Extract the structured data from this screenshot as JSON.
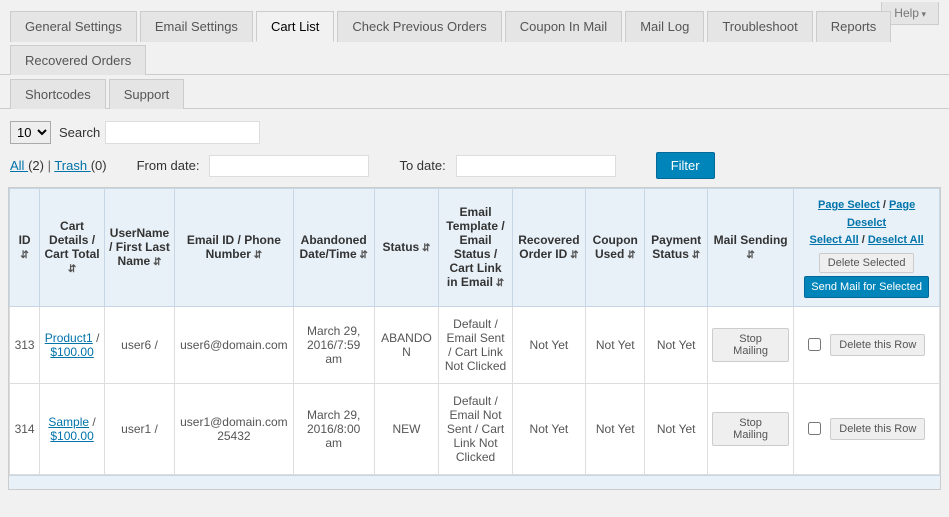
{
  "help": {
    "label": "Help"
  },
  "tabs": {
    "row1": [
      {
        "label": "General Settings",
        "active": false
      },
      {
        "label": "Email Settings",
        "active": false
      },
      {
        "label": "Cart List",
        "active": true
      },
      {
        "label": "Check Previous Orders",
        "active": false
      },
      {
        "label": "Coupon In Mail",
        "active": false
      },
      {
        "label": "Mail Log",
        "active": false
      },
      {
        "label": "Troubleshoot",
        "active": false
      },
      {
        "label": "Reports",
        "active": false
      },
      {
        "label": "Recovered Orders",
        "active": false
      }
    ],
    "row2": [
      {
        "label": "Shortcodes",
        "active": false
      },
      {
        "label": "Support",
        "active": false
      }
    ]
  },
  "toolbar": {
    "page_length": "10",
    "search_label": "Search",
    "search_value": ""
  },
  "filters": {
    "all_label": "All ",
    "all_count": "(2)",
    "sep": " | ",
    "trash_label": "Trash ",
    "trash_count": "(0)",
    "from_label": "From date:",
    "from_value": "",
    "to_label": "To date:",
    "to_value": "",
    "filter_btn": "Filter"
  },
  "table": {
    "headers": {
      "id": "ID",
      "cart": "Cart Details / Cart Total",
      "user": "UserName / First Last Name",
      "email": "Email ID / Phone Number",
      "date": "Abandoned Date/Time",
      "status": "Status",
      "template": "Email Template / Email Status / Cart Link in Email",
      "recov": "Recovered Order ID",
      "coupon": "Coupon Used",
      "pay": "Payment Status",
      "mail": "Mail Sending",
      "actions": {
        "page_select": "Page Select",
        "page_deselect": "Page Deselct",
        "select_all": "Select All",
        "deselect_all": "Deselct All",
        "delete_selected": "Delete Selected",
        "send_mail": "Send Mail for Selected"
      }
    },
    "rows": [
      {
        "id": "313",
        "cart_product": "Product1",
        "cart_sep": " / ",
        "cart_total": "$100.00",
        "user": "user6 /",
        "email": "user6@domain.com",
        "phone": "",
        "date": "March 29, 2016/7:59 am",
        "status": "ABANDON",
        "template": "Default / Email Sent / Cart Link Not Clicked",
        "recov": "Not Yet",
        "coupon": "Not Yet",
        "pay": "Not Yet",
        "mail_btn": "Stop Mailing",
        "delete_btn": "Delete this Row"
      },
      {
        "id": "314",
        "cart_product": "Sample",
        "cart_sep": " / ",
        "cart_total": "$100.00",
        "user": "user1 /",
        "email": "user1@domain.com",
        "phone": "25432",
        "date": "March 29, 2016/8:00 am",
        "status": "NEW",
        "template": "Default / Email Not Sent / Cart Link Not Clicked",
        "recov": "Not Yet",
        "coupon": "Not Yet",
        "pay": "Not Yet",
        "mail_btn": "Stop Mailing",
        "delete_btn": "Delete this Row"
      }
    ]
  }
}
